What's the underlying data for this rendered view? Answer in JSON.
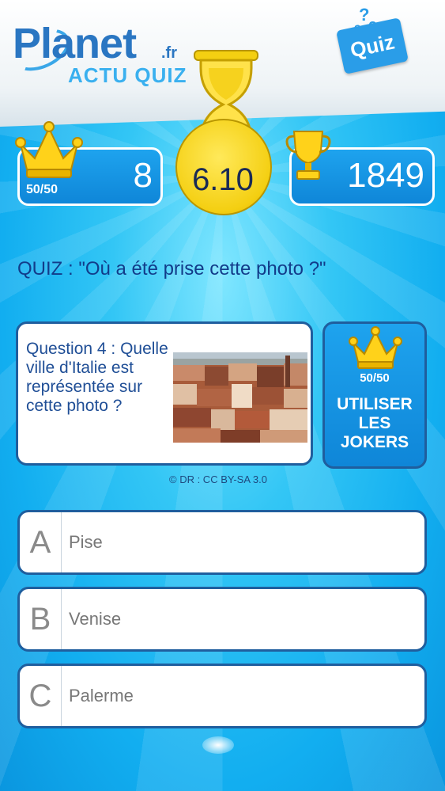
{
  "header": {
    "logo_planet": "Planet",
    "logo_fr": ".fr",
    "logo_actu": "ACTU QUIZ",
    "quiz_badge": "Quiz"
  },
  "stats": {
    "jokers_count": "50/50",
    "lives": "8",
    "timer": "6.10",
    "score": "1849"
  },
  "quiz_title": "QUIZ : \"Où a été prise cette photo ?\"",
  "question": {
    "text": "Question 4 : Quelle ville d'Italie est représentée sur cette photo ?",
    "credit": "© DR : CC BY-SA 3.0"
  },
  "joker": {
    "count": "50/50",
    "label_line1": "UTILISER",
    "label_line2": "LES",
    "label_line3": "JOKERS"
  },
  "answers": [
    {
      "letter": "A",
      "text": "Pise"
    },
    {
      "letter": "B",
      "text": "Venise"
    },
    {
      "letter": "C",
      "text": "Palerme"
    }
  ],
  "colors": {
    "accent_blue": "#1ea3ee",
    "dark_blue": "#1f5e9e",
    "timer_yellow": "#f4cf12"
  }
}
